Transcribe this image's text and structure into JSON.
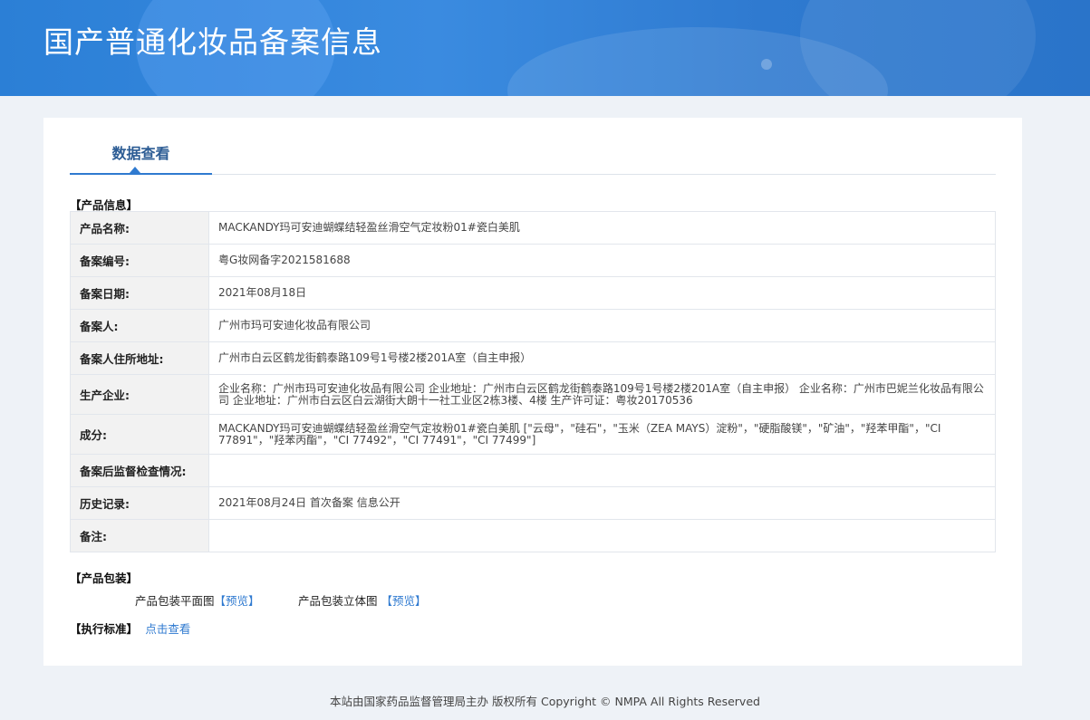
{
  "header": {
    "title": "国产普通化妆品备案信息"
  },
  "tabs": [
    {
      "label": "数据查看"
    }
  ],
  "product_info": {
    "section_title": "【产品信息】",
    "rows": [
      {
        "label": "产品名称:",
        "value": "MACKANDY玛可安迪蝴蝶结轻盈丝滑空气定妆粉01#瓷白美肌"
      },
      {
        "label": "备案编号:",
        "value": "粤G妆网备字2021581688"
      },
      {
        "label": "备案日期:",
        "value": "2021年08月18日"
      },
      {
        "label": "备案人:",
        "value": "广州市玛可安迪化妆品有限公司"
      },
      {
        "label": "备案人住所地址:",
        "value": "广州市白云区鹤龙街鹤泰路109号1号楼2楼201A室（自主申报）"
      },
      {
        "label": "生产企业:",
        "value": "企业名称：广州市玛可安迪化妆品有限公司 企业地址：广州市白云区鹤龙街鹤泰路109号1号楼2楼201A室（自主申报） 企业名称：广州市巴妮兰化妆品有限公司 企业地址：广州市白云区白云湖街大朗十一社工业区2栋3楼、4楼 生产许可证：粤妆20170536"
      },
      {
        "label": "成分:",
        "value": "MACKANDY玛可安迪蝴蝶结轻盈丝滑空气定妆粉01#瓷白美肌 [\"云母\"，\"硅石\"，\"玉米（ZEA MAYS）淀粉\"，\"硬脂酸镁\"，\"矿油\"，\"羟苯甲酯\"，\"CI 77891\"，\"羟苯丙酯\"，\"CI 77492\"，\"CI 77491\"，\"CI 77499\"]"
      },
      {
        "label": "备案后监督检查情况:",
        "value": ""
      },
      {
        "label": "历史记录:",
        "value": "2021年08月24日 首次备案 信息公开"
      },
      {
        "label": "备注:",
        "value": ""
      }
    ]
  },
  "packaging": {
    "section_title": "【产品包装】",
    "flat_label": "产品包装平面图",
    "flat_link": "【预览】",
    "solid_label": "产品包装立体图",
    "solid_link": "【预览】"
  },
  "standard": {
    "section_title": "【执行标准】",
    "link": "点击查看"
  },
  "footer": {
    "text": "本站由国家药品监督管理局主办 版权所有 Copyright © NMPA All Rights Reserved"
  }
}
